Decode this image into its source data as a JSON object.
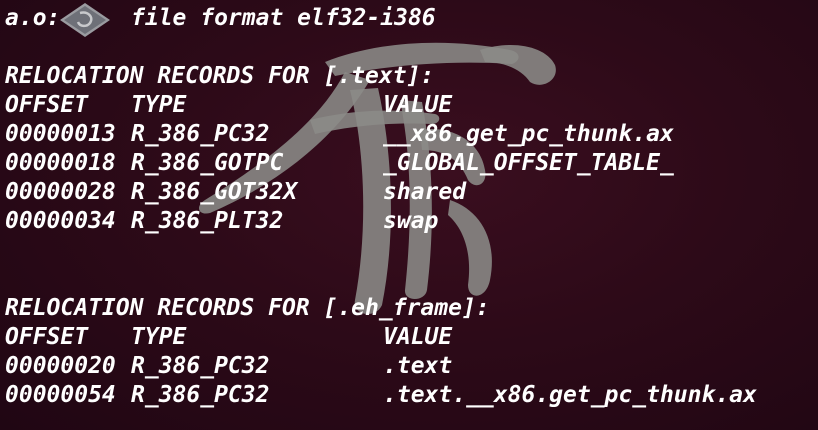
{
  "header": {
    "filename": "a.o:",
    "format": "file format elf32-i386"
  },
  "sections": [
    {
      "title": "RELOCATION RECORDS FOR [.text]:",
      "columns": [
        "OFFSET",
        "TYPE",
        "VALUE"
      ],
      "rows": [
        [
          "00000013",
          "R_386_PC32",
          "__x86.get_pc_thunk.ax"
        ],
        [
          "00000018",
          "R_386_GOTPC",
          "_GLOBAL_OFFSET_TABLE_"
        ],
        [
          "00000028",
          "R_386_GOT32X",
          "shared"
        ],
        [
          "00000034",
          "R_386_PLT32",
          "swap"
        ]
      ]
    },
    {
      "title": "RELOCATION RECORDS FOR [.eh_frame]:",
      "columns": [
        "OFFSET",
        "TYPE",
        "VALUE"
      ],
      "rows": [
        [
          "00000020",
          "R_386_PC32",
          ".text"
        ],
        [
          "00000054",
          "R_386_PC32",
          ".text.__x86.get_pc_thunk.ax"
        ]
      ]
    }
  ],
  "colors": {
    "background": "#2a0a1a",
    "text": "#ffffff",
    "watermark": "#8a8a86"
  },
  "icons": {
    "logo": "ubuntu-logo-icon",
    "watermark": "calligraphy-watermark-icon"
  }
}
